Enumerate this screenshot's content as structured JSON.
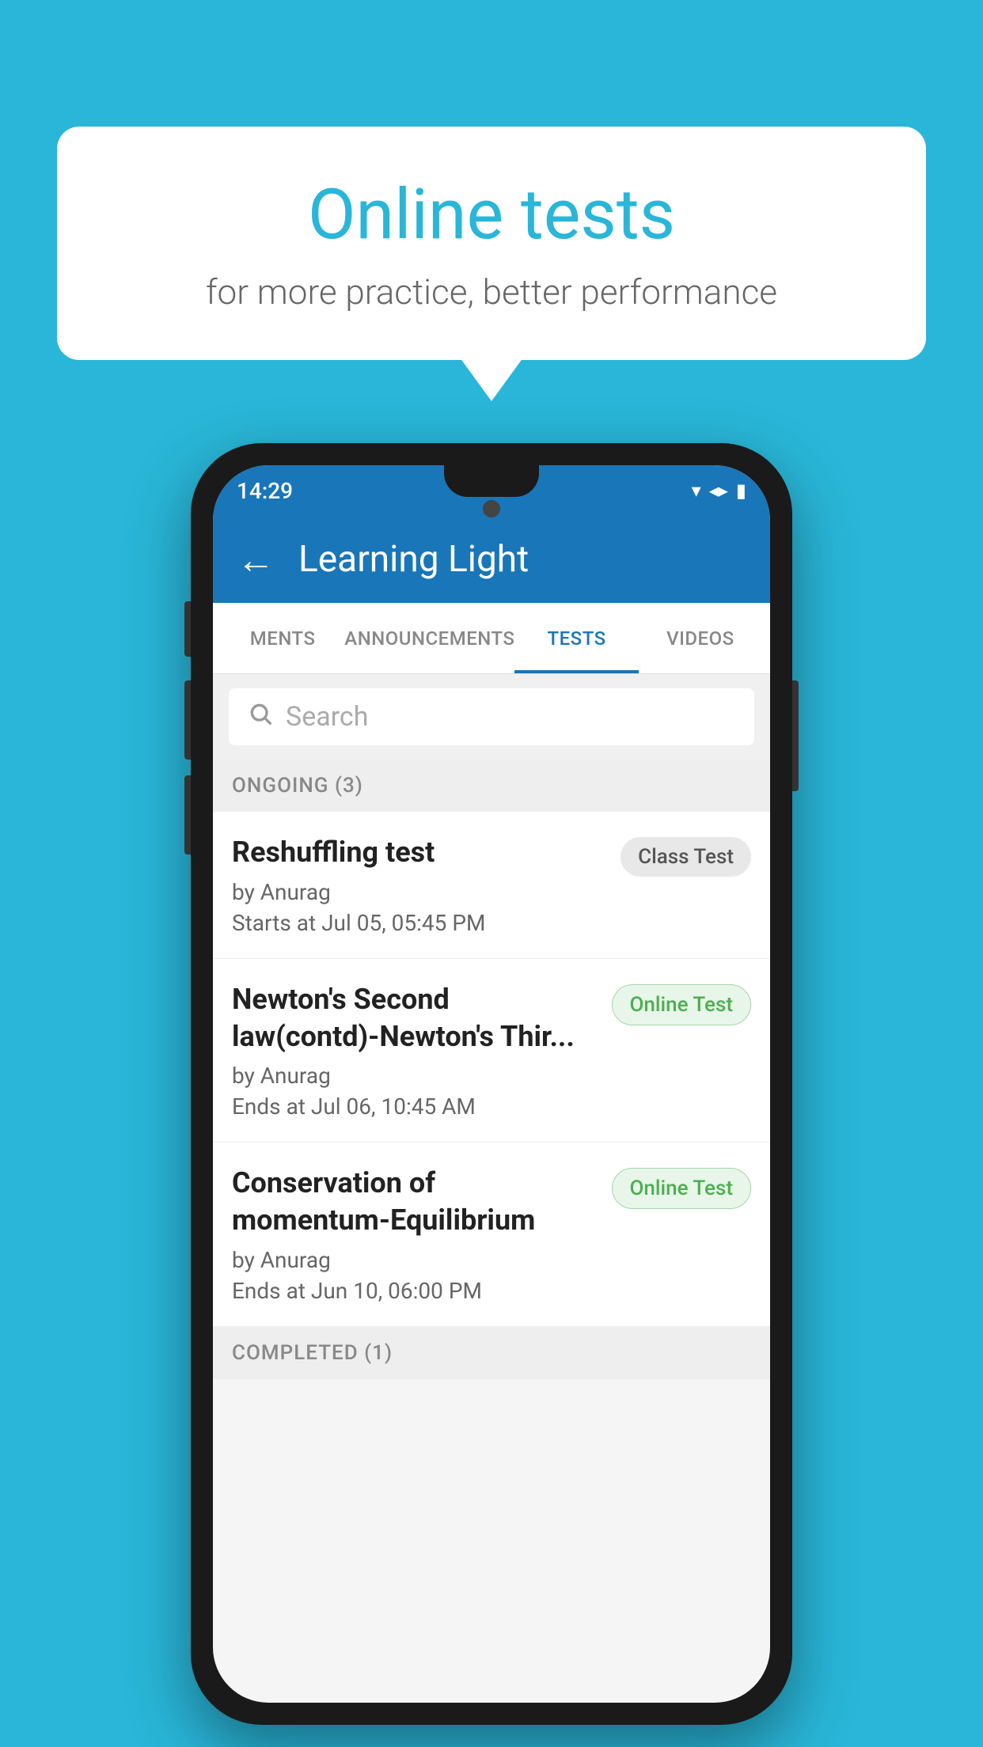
{
  "background": {
    "color": "#29b6d8"
  },
  "speech_bubble": {
    "title": "Online tests",
    "subtitle": "for more practice, better performance"
  },
  "phone": {
    "status_bar": {
      "time": "14:29"
    },
    "app_bar": {
      "title": "Learning Light",
      "back_label": "←"
    },
    "tabs": [
      {
        "label": "MENTS",
        "active": false
      },
      {
        "label": "ANNOUNCEMENTS",
        "active": false
      },
      {
        "label": "TESTS",
        "active": true
      },
      {
        "label": "VIDEOS",
        "active": false
      }
    ],
    "search": {
      "placeholder": "Search"
    },
    "ongoing_section": {
      "label": "ONGOING (3)"
    },
    "tests": [
      {
        "name": "Reshuffling test",
        "author": "by Anurag",
        "time_label": "Starts at",
        "time": "Jul 05, 05:45 PM",
        "badge": "Class Test",
        "badge_type": "class"
      },
      {
        "name": "Newton's Second law(contd)-Newton's Thir...",
        "author": "by Anurag",
        "time_label": "Ends at",
        "time": "Jul 06, 10:45 AM",
        "badge": "Online Test",
        "badge_type": "online"
      },
      {
        "name": "Conservation of momentum-Equilibrium",
        "author": "by Anurag",
        "time_label": "Ends at",
        "time": "Jun 10, 06:00 PM",
        "badge": "Online Test",
        "badge_type": "online"
      }
    ],
    "completed_section": {
      "label": "COMPLETED (1)"
    }
  }
}
